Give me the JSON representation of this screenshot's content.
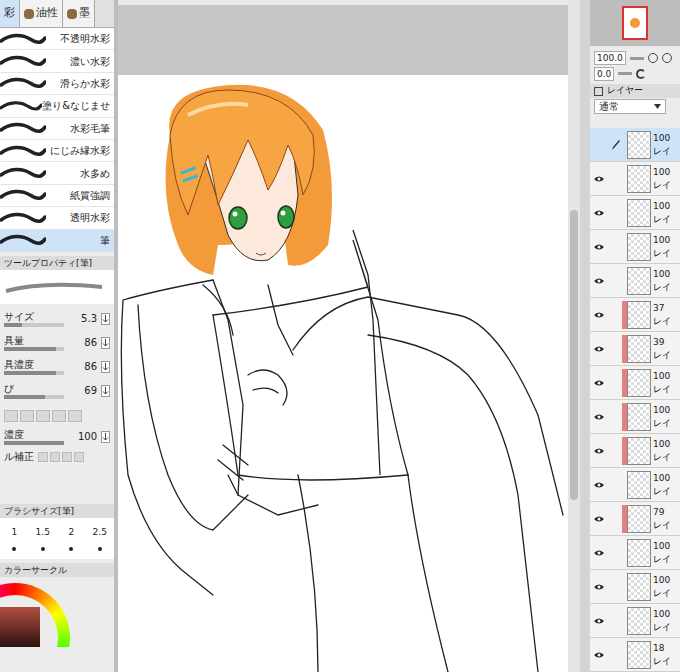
{
  "left_panel": {
    "tabs": [
      {
        "label": "彩",
        "selected": true
      },
      {
        "label": "油性",
        "selected": false
      },
      {
        "label": "墨",
        "selected": false
      }
    ],
    "brushes": [
      {
        "label": "不透明水彩",
        "selected": false
      },
      {
        "label": "濃い水彩",
        "selected": false
      },
      {
        "label": "滑らか水彩",
        "selected": false
      },
      {
        "label": "塗り&なじませ",
        "selected": false
      },
      {
        "label": "水彩毛筆",
        "selected": false
      },
      {
        "label": "にじみ縁水彩",
        "selected": false
      },
      {
        "label": "水多め",
        "selected": false
      },
      {
        "label": "紙質強調",
        "selected": false
      },
      {
        "label": "透明水彩",
        "selected": false
      },
      {
        "label": "筆",
        "selected": true
      }
    ],
    "tool_property": {
      "title": "ツールプロパティ[筆]",
      "properties": [
        {
          "label": "サイズ",
          "value": "5.3",
          "level": 0.3
        },
        {
          "label": "具量",
          "value": "86",
          "level": 0.86
        },
        {
          "label": "具濃度",
          "value": "86",
          "level": 0.86
        },
        {
          "label": "び",
          "value": "69",
          "level": 0.69
        }
      ],
      "density": {
        "label": "濃度",
        "value": "100",
        "level": 1
      },
      "correction": {
        "label": "ル補正"
      }
    },
    "brush_size": {
      "title": "ブラシサイズ[筆]",
      "sizes": [
        "1",
        "1.5",
        "2",
        "2.5"
      ]
    },
    "color_panel": {
      "title": "カラーサークル"
    }
  },
  "navigator": {
    "zoom": "100.0",
    "rotation": "0.0"
  },
  "layer_panel": {
    "tab": "レイヤー",
    "blend_mode": "通常",
    "layers": [
      {
        "opacity": "100",
        "name": "レイ",
        "visible": false,
        "selected": true,
        "marked": false
      },
      {
        "opacity": "100",
        "name": "レイ",
        "visible": true,
        "selected": false,
        "marked": false
      },
      {
        "opacity": "100",
        "name": "レイ",
        "visible": true,
        "selected": false,
        "marked": false
      },
      {
        "opacity": "100",
        "name": "レイ",
        "visible": true,
        "selected": false,
        "marked": false
      },
      {
        "opacity": "100",
        "name": "レイ",
        "visible": true,
        "selected": false,
        "marked": false
      },
      {
        "opacity": "37",
        "name": "レイ",
        "visible": true,
        "selected": false,
        "marked": true
      },
      {
        "opacity": "39",
        "name": "レイ",
        "visible": true,
        "selected": false,
        "marked": true
      },
      {
        "opacity": "100",
        "name": "レイ",
        "visible": true,
        "selected": false,
        "marked": true
      },
      {
        "opacity": "100",
        "name": "レイ",
        "visible": true,
        "selected": false,
        "marked": true
      },
      {
        "opacity": "100",
        "name": "レイ",
        "visible": true,
        "selected": false,
        "marked": true
      },
      {
        "opacity": "100",
        "name": "レイ",
        "visible": true,
        "selected": false,
        "marked": false
      },
      {
        "opacity": "79",
        "name": "レイ",
        "visible": true,
        "selected": false,
        "marked": true
      },
      {
        "opacity": "100",
        "name": "レイ",
        "visible": true,
        "selected": false,
        "marked": false
      },
      {
        "opacity": "100",
        "name": "レイ",
        "visible": true,
        "selected": false,
        "marked": false
      },
      {
        "opacity": "100",
        "name": "レイ",
        "visible": true,
        "selected": false,
        "marked": false
      },
      {
        "opacity": "18",
        "name": "レイ",
        "visible": true,
        "selected": false,
        "marked": false
      }
    ]
  }
}
